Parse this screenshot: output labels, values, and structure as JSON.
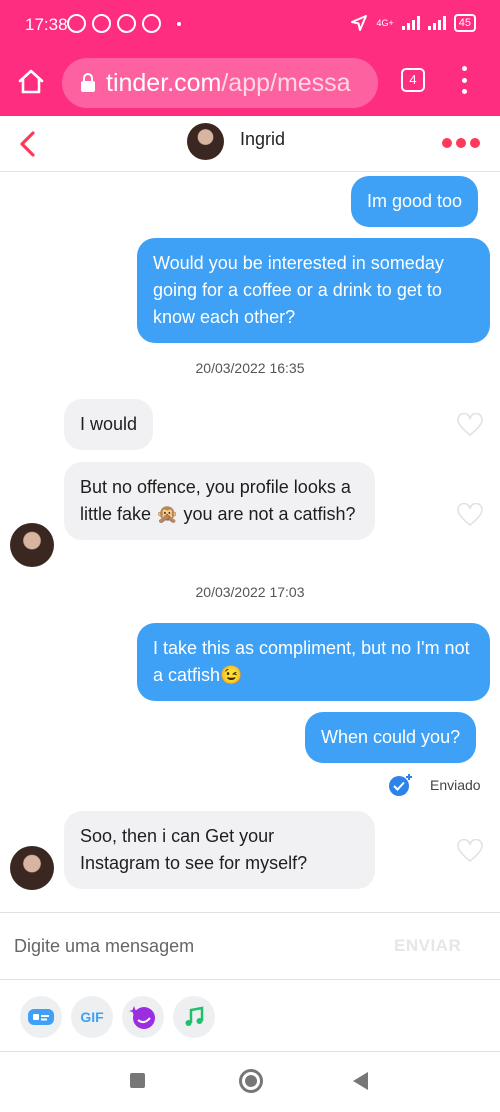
{
  "status_bar": {
    "time": "17:38",
    "network_label": "4G+",
    "battery": "45"
  },
  "browser": {
    "url_main": "tinder.com",
    "url_path": "/app/messa",
    "tab_count": "4"
  },
  "chat": {
    "contact_name": "Ingrid",
    "messages": [
      {
        "dir": "out",
        "text": "Im good too"
      },
      {
        "dir": "out",
        "text": "Would you be interested in someday going for a coffee or a drink to get to know each other?"
      },
      {
        "type": "timestamp",
        "text": "20/03/2022 16:35"
      },
      {
        "dir": "in",
        "text": "I would"
      },
      {
        "dir": "in",
        "text": "But no offence, you profile looks a little fake 🙊 you are not a catfish?"
      },
      {
        "type": "timestamp",
        "text": "20/03/2022 17:03"
      },
      {
        "dir": "out",
        "text": "I take this as compliment, but no I'm not a catfish😉"
      },
      {
        "dir": "out",
        "text": "When could you?"
      },
      {
        "dir": "in",
        "text": "Soo, then i can Get your Instagram to see for myself?"
      }
    ],
    "sent_status": "Enviado"
  },
  "composer": {
    "placeholder": "Digite uma mensagem",
    "send_label": "ENVIAR"
  },
  "tools": {
    "gif_label": "GIF"
  },
  "colors": {
    "brand": "#fe2d7f",
    "outgoing_bubble": "#3ea1f6",
    "incoming_bubble": "#f1f1f3",
    "accent_red": "#fd3a5b"
  }
}
